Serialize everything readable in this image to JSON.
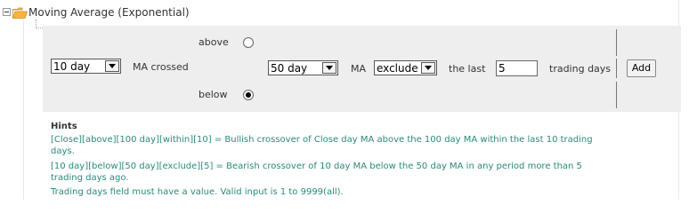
{
  "section": {
    "title": "Moving Average (Exponential)"
  },
  "form": {
    "above_label": "above",
    "below_label": "below",
    "above_selected": false,
    "below_selected": true,
    "left_select": "10 day",
    "ma_crossed_label": "MA crossed",
    "right_select": "50 day",
    "ma_label": "MA",
    "mode_select": "exclude",
    "the_last_label": "the last",
    "days_value": "5",
    "trading_days_label": "trading days",
    "add_button": "Add"
  },
  "hints": {
    "title": "Hints",
    "line1a": "[Close][above][100 day][within][10] = Bullish crossover of Close day MA above the 100 day MA within the last 10 trading",
    "line1b": "days.",
    "line2a": "[10 day][below][50 day][exclude][5] = Bearish crossover of 10 day MA below the 50 day MA in any period more than 5",
    "line2b": "trading days ago.",
    "line3": "Trading days field must have a value. Valid input is 1 to 9999(all)."
  },
  "colors": {
    "hint_text": "#2a8a7a",
    "panel_bg": "#eeeeee",
    "folder": "#f0a830"
  },
  "icons": [
    "collapse-toggle-icon",
    "folder-icon",
    "chevron-down-icon"
  ]
}
